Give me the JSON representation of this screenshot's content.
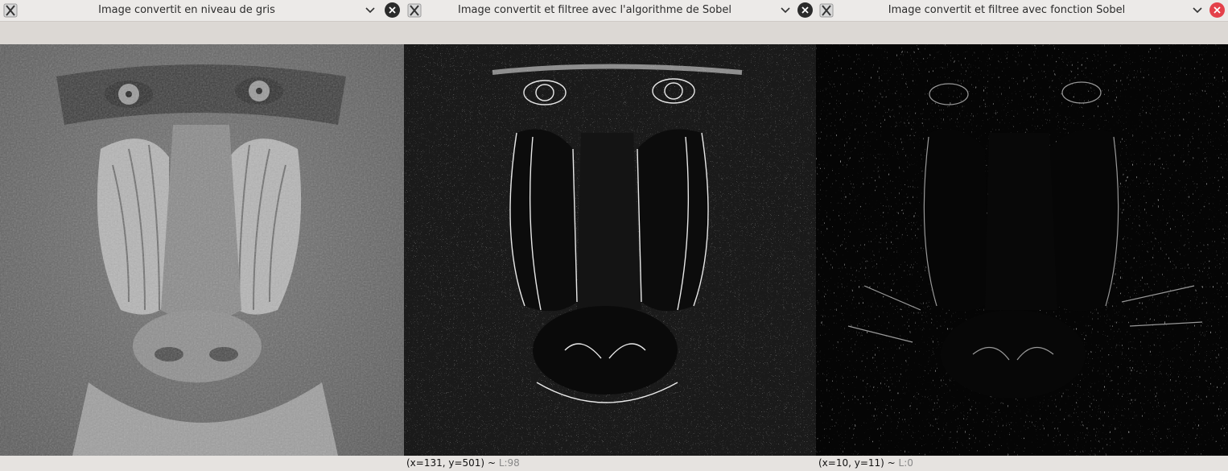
{
  "windows": [
    {
      "title": "Image convertit en niveau de gris",
      "close_style": "dark",
      "image": "grayscale",
      "status": {
        "coords": "",
        "sep": "",
        "lum": ""
      }
    },
    {
      "title": "Image convertit et filtree avec l'algorithme de Sobel",
      "close_style": "dark",
      "image": "sobel-algorithm",
      "status": {
        "coords": "(x=131, y=501)",
        "sep": " ~ ",
        "lum": "L:98"
      }
    },
    {
      "title": "Image convertit et filtree avec fonction Sobel",
      "close_style": "red",
      "image": "sobel-function",
      "status": {
        "coords": "(x=10, y=11)",
        "sep": " ~ ",
        "lum": "L:0"
      }
    }
  ],
  "icons": {
    "app": "x11-app-icon",
    "menu": "chevron-down-icon",
    "close": "close-icon"
  },
  "colors": {
    "titlebar": "#eceae8",
    "background": "#dcd8d4",
    "close_dark": "#2b2b2b",
    "close_red": "#e4414a",
    "status_lum": "#888888"
  }
}
